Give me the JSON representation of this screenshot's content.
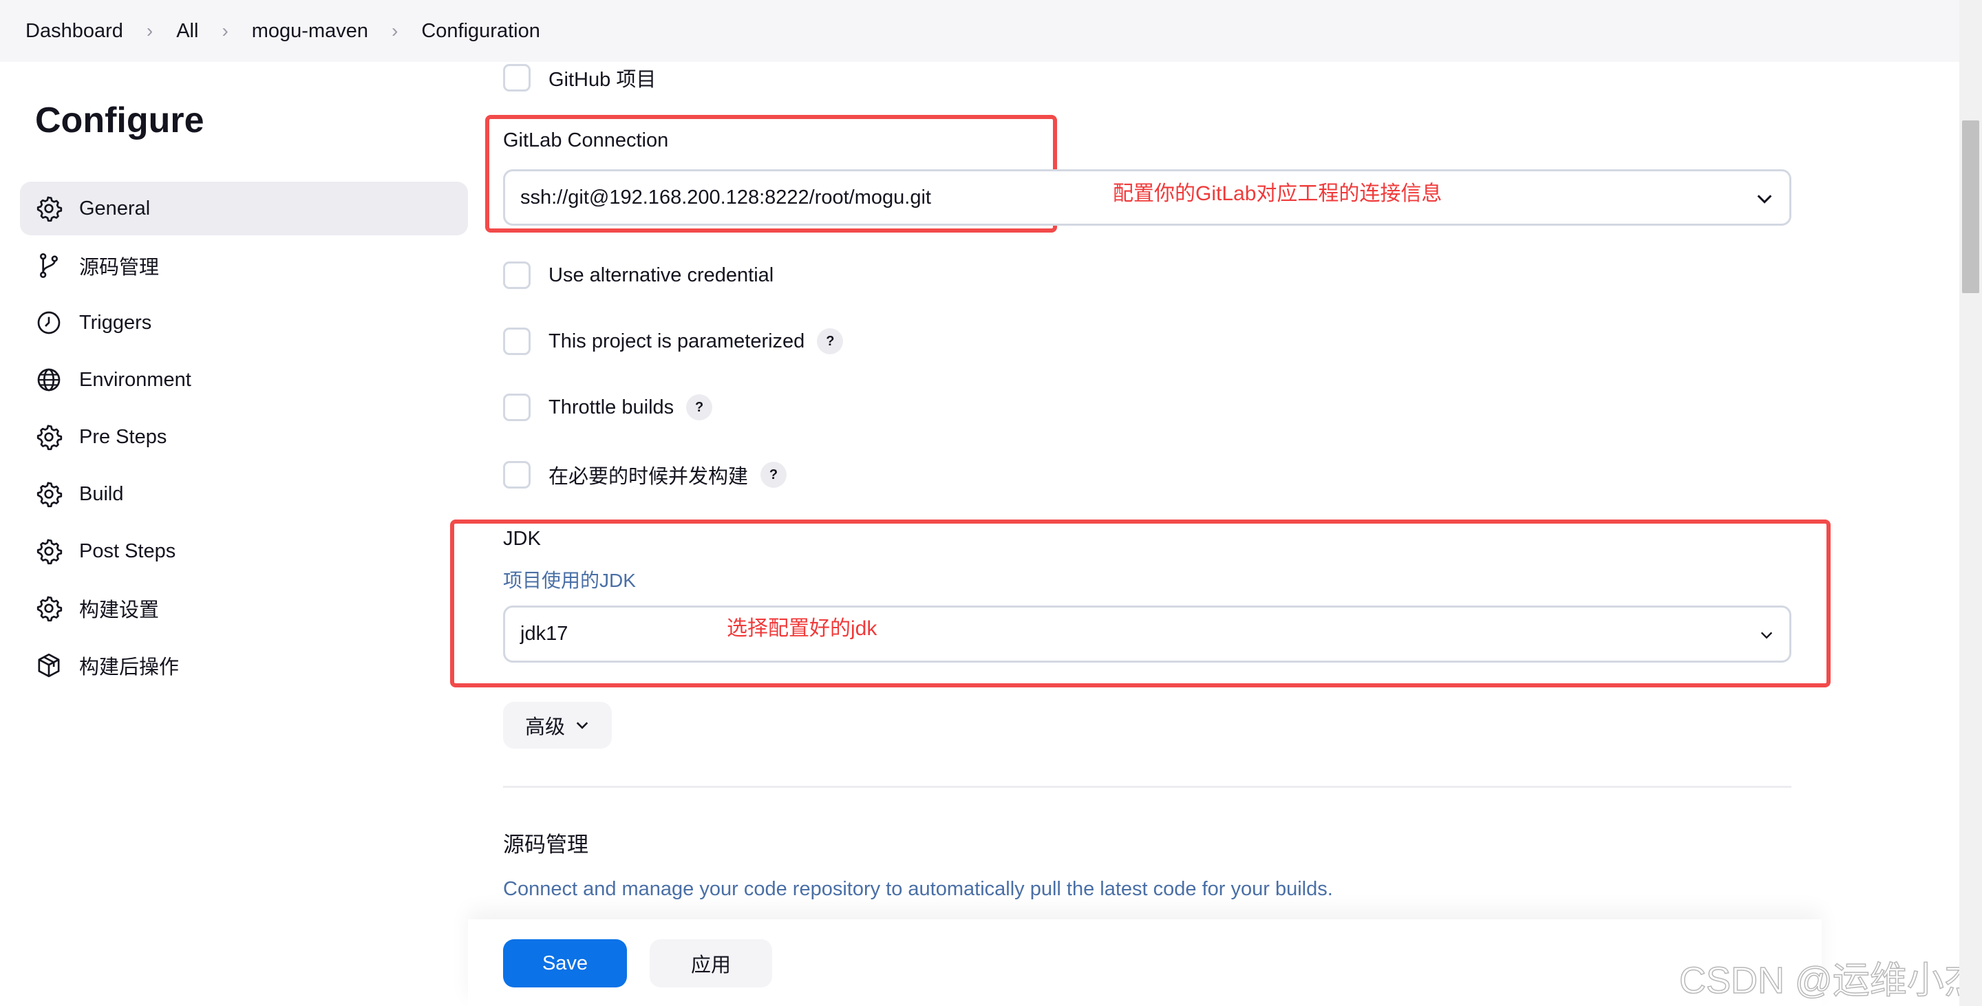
{
  "breadcrumb": [
    "Dashboard",
    "All",
    "mogu-maven",
    "Configuration"
  ],
  "page_title": "Configure",
  "sidebar": {
    "items": [
      {
        "label": "General",
        "icon": "gear-icon",
        "active": true
      },
      {
        "label": "源码管理",
        "icon": "branch-icon"
      },
      {
        "label": "Triggers",
        "icon": "clock-icon"
      },
      {
        "label": "Environment",
        "icon": "globe-icon"
      },
      {
        "label": "Pre Steps",
        "icon": "gear-icon"
      },
      {
        "label": "Build",
        "icon": "gear-icon"
      },
      {
        "label": "Post Steps",
        "icon": "gear-icon"
      },
      {
        "label": "构建设置",
        "icon": "gear-icon"
      },
      {
        "label": "构建后操作",
        "icon": "package-icon"
      }
    ]
  },
  "options": {
    "github_project": "GitHub 项目",
    "use_alt_credential": "Use alternative credential",
    "parameterized": "This project is parameterized",
    "throttle": "Throttle builds",
    "concurrent": "在必要的时候并发构建",
    "help": "?"
  },
  "gitlab": {
    "label": "GitLab Connection",
    "value": "ssh://git@192.168.200.128:8222/root/mogu.git",
    "annotation": "配置你的GitLab对应工程的连接信息"
  },
  "jdk": {
    "label": "JDK",
    "description": "项目使用的JDK",
    "value": "jdk17",
    "annotation": "选择配置好的jdk"
  },
  "advanced_label": "高级",
  "scm": {
    "title": "源码管理",
    "description": "Connect and manage your code repository to automatically pull the latest code for your builds."
  },
  "footer": {
    "save": "Save",
    "apply": "应用"
  },
  "watermark": "CSDN @运维小杰",
  "colors": {
    "accent": "#0b72e7",
    "annotation": "#f03a3a"
  }
}
